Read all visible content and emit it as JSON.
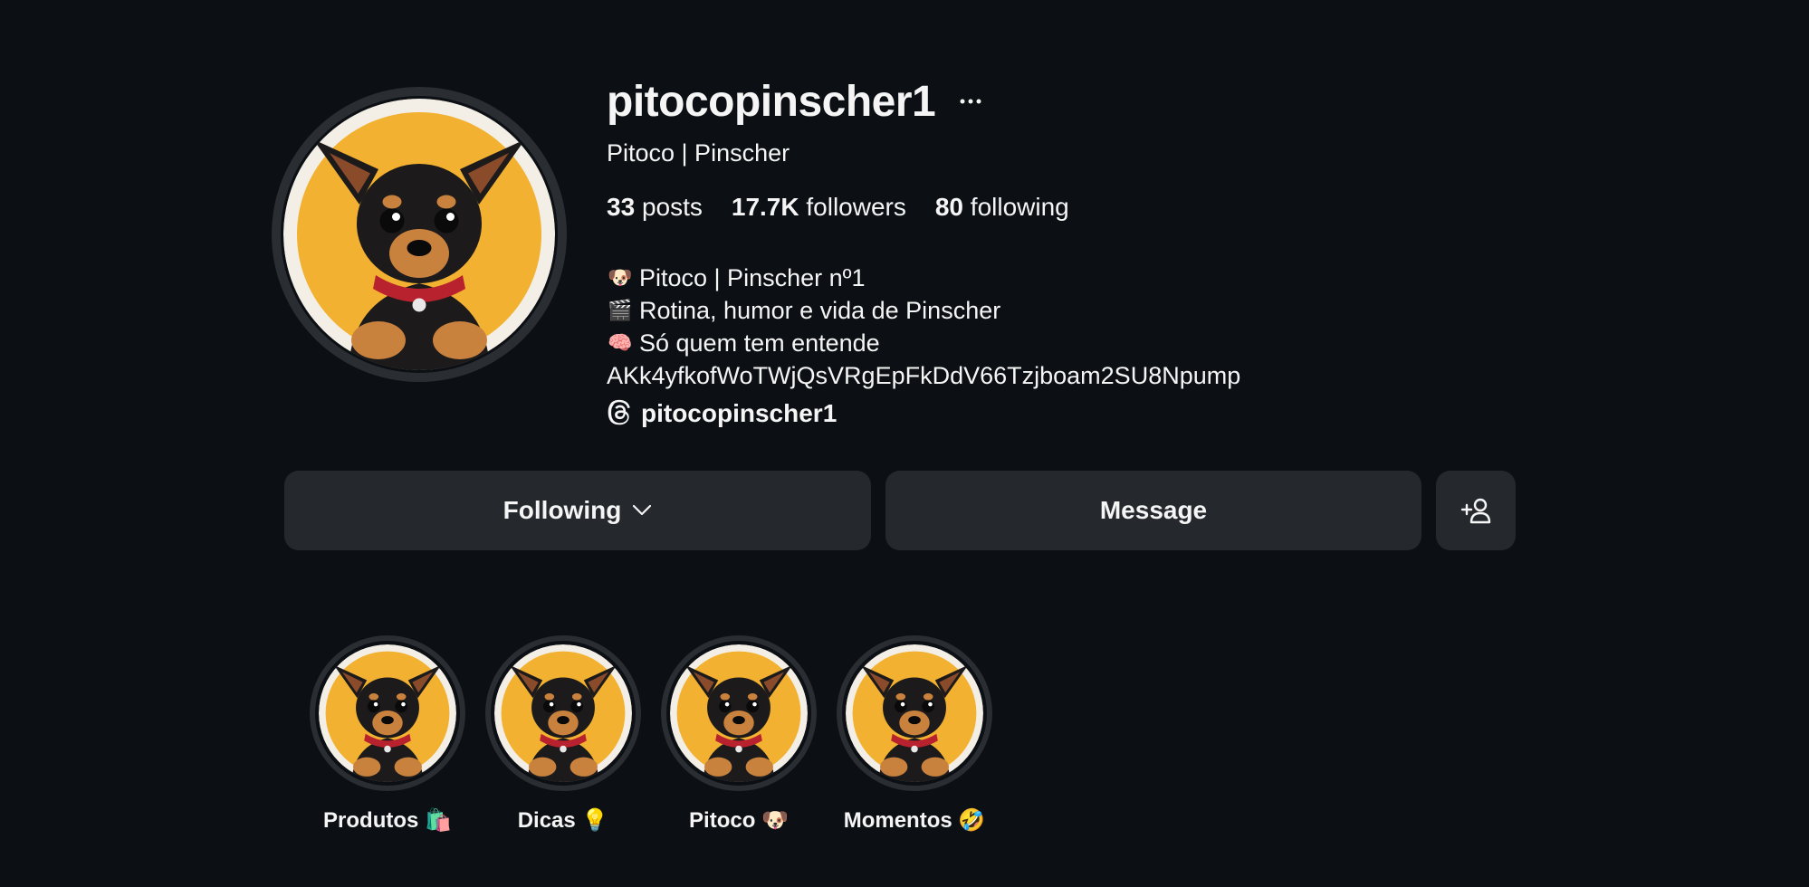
{
  "profile": {
    "username": "pitocopinscher1",
    "full_name": "Pitoco | Pinscher",
    "avatar_icon": "pinscher-puppy-avatar",
    "stats": {
      "posts_count": "33",
      "posts_label": "posts",
      "followers_count": "17.7K",
      "followers_label": "followers",
      "following_count": "80",
      "following_label": "following"
    },
    "bio": [
      {
        "emoji": "🐶",
        "text": "Pitoco | Pinscher nº1"
      },
      {
        "emoji": "🎬",
        "text": "Rotina, humor e vida de Pinscher"
      },
      {
        "emoji": "🧠",
        "text": "Só quem tem entende"
      },
      {
        "emoji": "",
        "text": "AKk4yfkofWoTWjQsVRgEpFkDdV66Tzjboam2SU8Npump"
      }
    ],
    "threads_handle": "pitocopinscher1"
  },
  "actions": {
    "following_label": "Following",
    "message_label": "Message"
  },
  "highlights": [
    {
      "label": "Produtos 🛍️"
    },
    {
      "label": "Dicas 💡"
    },
    {
      "label": "Pitoco 🐶"
    },
    {
      "label": "Momentos 🤣"
    }
  ],
  "colors": {
    "background": "#0c1014",
    "button": "#25292e",
    "text": "#f5f5f5",
    "avatar_yellow": "#f2b130"
  }
}
